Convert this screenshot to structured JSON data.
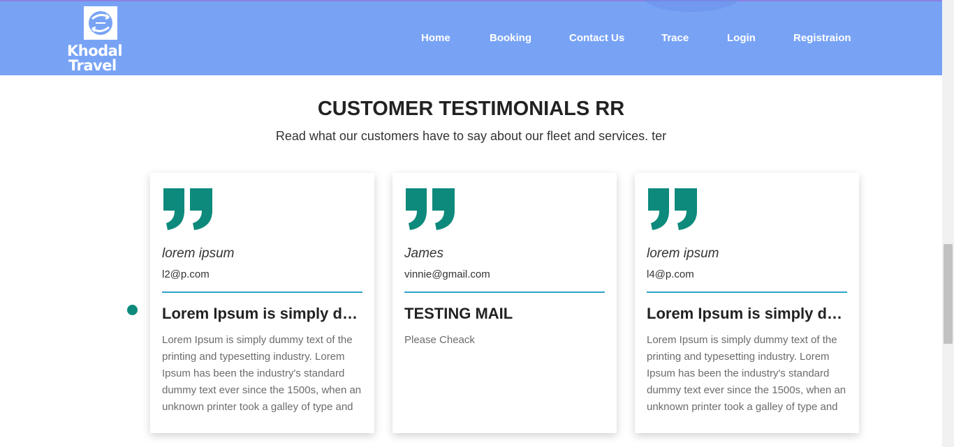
{
  "nav": {
    "brand_line1": "Khodal",
    "brand_line2": "Travel",
    "logo_icon": "globe-arrows-icon",
    "links": [
      "Home",
      "Booking",
      "Contact Us",
      "Trace",
      "Login",
      "Registraion"
    ]
  },
  "testimonials": {
    "title": "CUSTOMER TESTIMONIALS RR",
    "subtitle": "Read what our customers have to say about our fleet and services. ter",
    "cards": [
      {
        "name": "lorem ipsum",
        "email": "l2@p.com",
        "heading": "Lorem Ipsum is simply dummy text",
        "body": "Lorem Ipsum is simply dummy text of the printing and typesetting industry. Lorem Ipsum has been the industry's standard dummy text ever since the 1500s, when an unknown printer took a galley of type and"
      },
      {
        "name": "James",
        "email": "vinnie@gmail.com",
        "heading": "TESTING MAIL",
        "body": "Please Cheack"
      },
      {
        "name": "lorem ipsum",
        "email": "l4@p.com",
        "heading": "Lorem Ipsum is simply dummy text",
        "body": "Lorem Ipsum is simply dummy text of the printing and typesetting industry. Lorem Ipsum has been the industry's standard dummy text ever since the 1500s, when an unknown printer took a galley of type and"
      }
    ]
  },
  "colors": {
    "navbar": "#78a3f5",
    "accent": "#0d8a7b",
    "divider": "#2ea2c8"
  }
}
